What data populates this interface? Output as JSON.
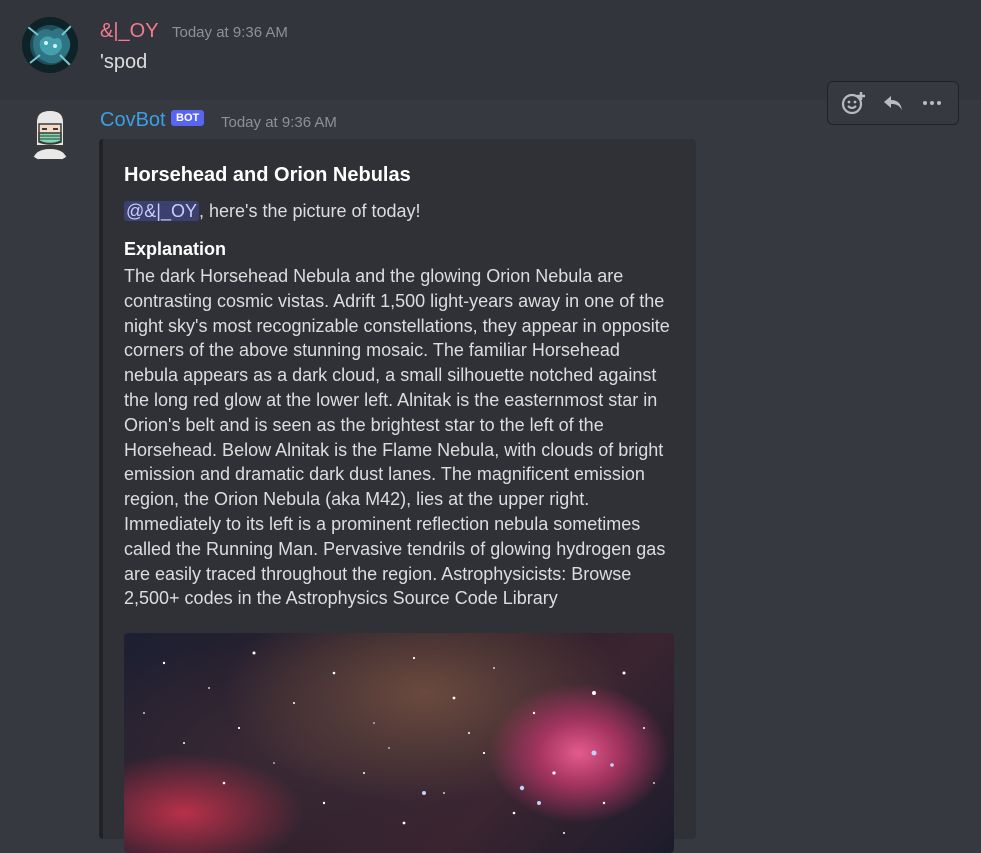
{
  "messages": [
    {
      "username": "&|_OY",
      "timestamp": "Today at 9:36 AM",
      "content": "'spod"
    },
    {
      "username": "CovBot",
      "bot_tag": "BOT",
      "timestamp": "Today at 9:36 AM",
      "embed": {
        "title": "Horsehead and Orion Nebulas",
        "mention": "@&|_OY",
        "mention_suffix": ", here's the picture of today!",
        "field_name": "Explanation",
        "field_value": "The dark Horsehead Nebula and the glowing Orion Nebula are contrasting cosmic vistas. Adrift 1,500 light-years away in one of the night sky's most recognizable constellations, they appear in opposite corners of the above stunning mosaic. The familiar Horsehead nebula appears as a dark cloud, a small silhouette notched against the long red glow at the lower left. Alnitak is the easternmost star in Orion's belt and is seen as the brightest star to the left of the Horsehead. Below Alnitak is the Flame Nebula, with clouds of bright emission and dramatic dark dust lanes. The magnificent emission region, the Orion Nebula (aka M42), lies at the upper right. Immediately to its left is a prominent reflection nebula sometimes called the Running Man. Pervasive tendrils of glowing hydrogen gas are easily traced throughout the region. Astrophysicists: Browse 2,500+ codes in the Astrophysics Source Code Library"
      }
    }
  ],
  "toolbar": {
    "icons": [
      "add-reaction-icon",
      "reply-icon",
      "more-options-icon"
    ]
  },
  "colors": {
    "background": "#36393f",
    "hover_background": "#32353b",
    "username1": "#f47b8f",
    "username2": "#3ba0e4",
    "bot_tag": "#5865f2",
    "embed_background": "#2f3136"
  }
}
